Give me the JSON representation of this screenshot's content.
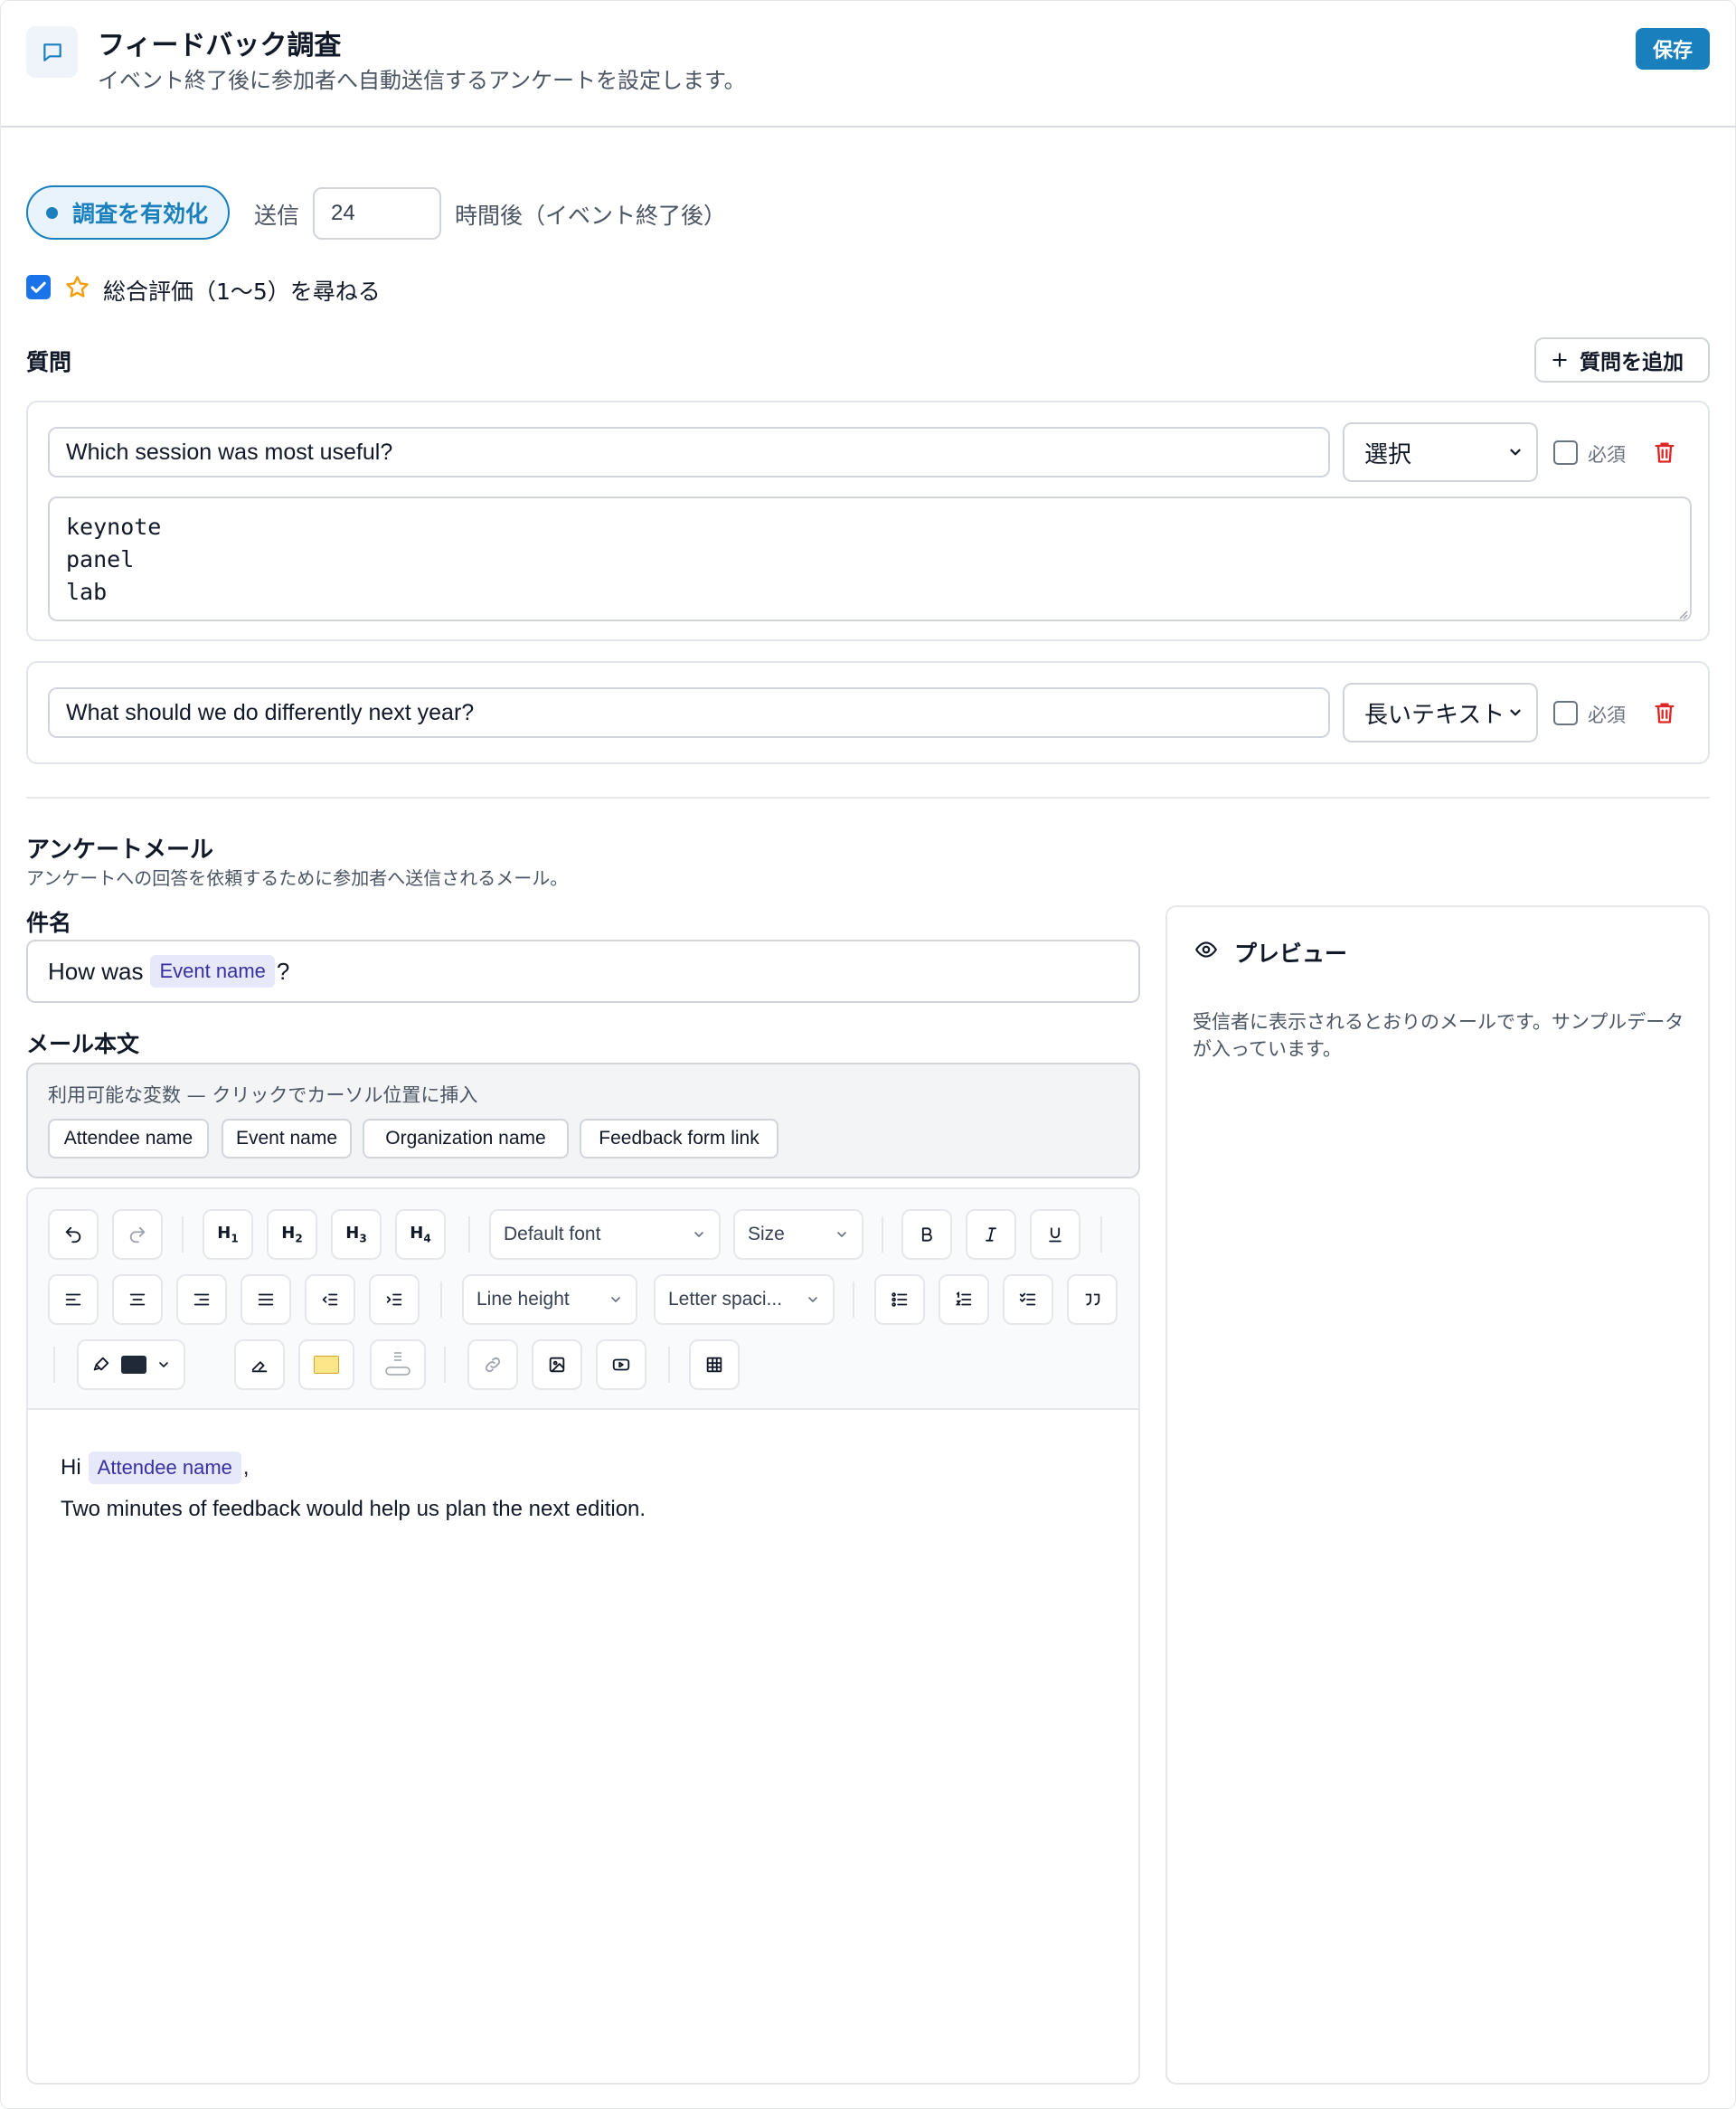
{
  "header": {
    "icon": "chat-bubble-icon",
    "title": "フィードバック調査",
    "subtitle": "イベント終了後に参加者へ自動送信するアンケートを設定します。",
    "save_label": "保存"
  },
  "settings": {
    "toggle_label": "調査を有効化",
    "send_label": "送信",
    "hours_value": "24",
    "hours_suffix": "時間後（イベント終了後）",
    "rating_checked": true,
    "rating_label": "総合評価（1〜5）を尋ねる"
  },
  "questions": {
    "heading": "質問",
    "add_label": "質問を追加",
    "required_label": "必須",
    "items": [
      {
        "text": "Which session was most useful?",
        "type": "選択",
        "options": [
          "keynote",
          "panel",
          "lab"
        ],
        "required": false
      },
      {
        "text": "What should we do differently next year?",
        "type": "長いテキスト",
        "required": false
      }
    ]
  },
  "email": {
    "title": "アンケートメール",
    "subtitle": "アンケートへの回答を依頼するために参加者へ送信されるメール。",
    "subject_label": "件名",
    "subject_prefix": "How was",
    "subject_variable": "Event name",
    "subject_suffix": "?",
    "body_label": "メール本文",
    "variables_hint": "利用可能な変数 — クリックでカーソル位置に挿入",
    "variables": [
      "Attendee name",
      "Event name",
      "Organization name",
      "Feedback form link"
    ],
    "toolbar": {
      "font": "Default font",
      "size": "Size",
      "line_height": "Line height",
      "letter_spacing": "Letter spaci...",
      "text_color": "#1f2937",
      "highlight_color": "#fde68a"
    },
    "body": {
      "greeting": "Hi",
      "greeting_variable": "Attendee name",
      "greeting_suffix": ",",
      "line2": "Two minutes of feedback would help us plan the next edition."
    }
  },
  "preview": {
    "title": "プレビュー",
    "text": "受信者に表示されるとおりのメールです。サンプルデータが入っています。"
  },
  "colors": {
    "accent": "#1a7fbd",
    "danger": "#dc2626",
    "chip_bg": "#e7e9fb",
    "chip_text": "#3730a3"
  }
}
